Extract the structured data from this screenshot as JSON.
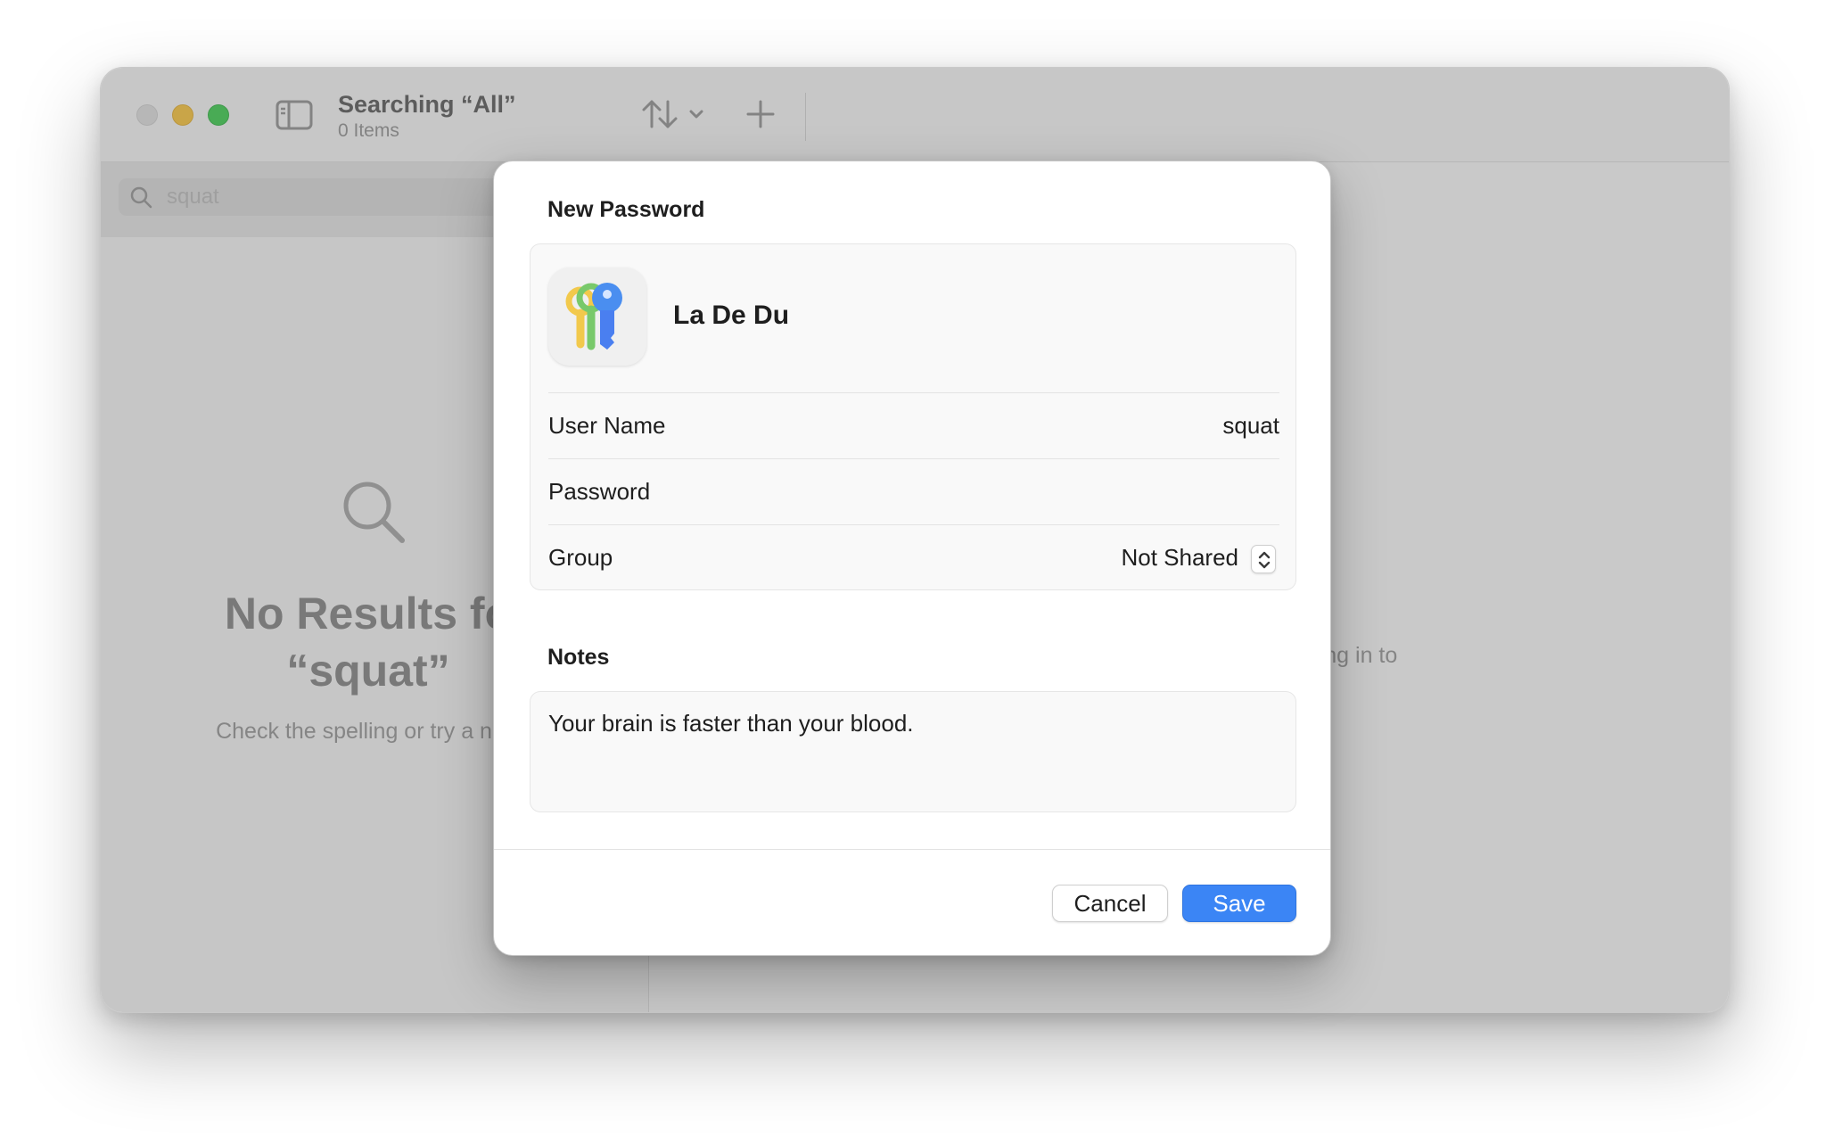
{
  "window": {
    "title": "Searching “All”",
    "subtitle": "0 Items"
  },
  "toolbar": {
    "sidebar_toggle_icon": "sidebar-icon",
    "sort_icon": "sort-arrows-icon",
    "add_icon": "plus-icon"
  },
  "search": {
    "value": "squat",
    "icon": "search-icon"
  },
  "empty_state": {
    "title_line1": "No Results fo",
    "title_line2": "“squat”",
    "hint": "Check the spelling or try a new",
    "icon": "magnifier-icon"
  },
  "detail": {
    "hint_fragment": "n signing in to"
  },
  "sheet": {
    "title": "New Password",
    "site_name": "La De Du",
    "app_icon": "passwords-keys-icon",
    "fields": {
      "user_name_label": "User Name",
      "user_name_value": "squat",
      "password_label": "Password",
      "password_value": "",
      "group_label": "Group",
      "group_value": "Not Shared"
    },
    "notes_title": "Notes",
    "notes_text": "Your brain is faster than your blood.",
    "cancel_label": "Cancel",
    "save_label": "Save"
  },
  "colors": {
    "accent": "#3b85f5",
    "traffic_close": "#dcdcdc",
    "traffic_min": "#f7bf2e",
    "traffic_max": "#2fc842"
  }
}
